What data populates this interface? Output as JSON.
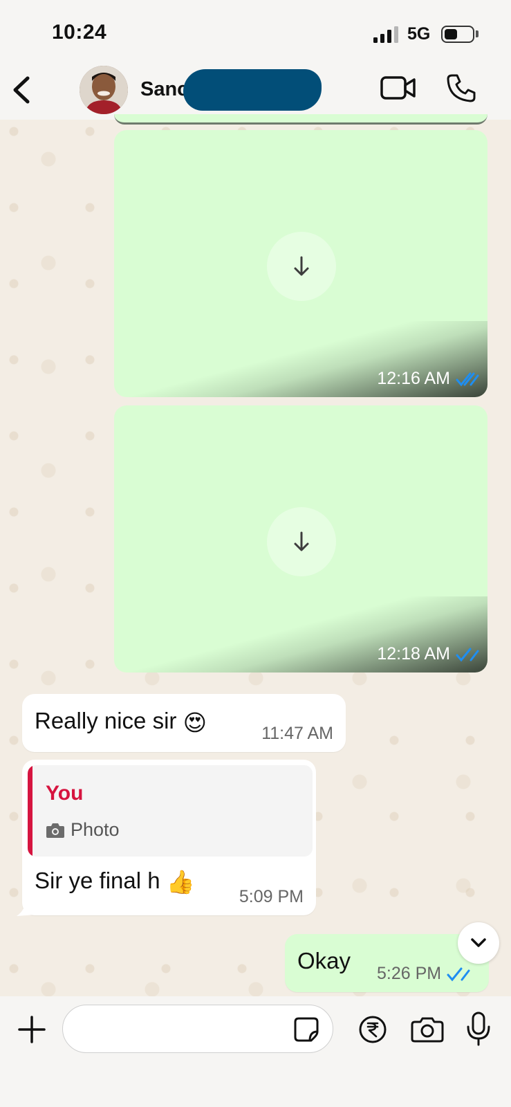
{
  "status_bar": {
    "time": "10:24",
    "network": "5G",
    "icons": [
      "signal-icon",
      "battery-icon"
    ]
  },
  "header": {
    "contact_name": "Sanc",
    "icons": [
      "back-icon",
      "video-call-icon",
      "voice-call-icon"
    ]
  },
  "messages": [
    {
      "type": "image",
      "direction": "outgoing",
      "time": "12:16 AM",
      "status": "read"
    },
    {
      "type": "image",
      "direction": "outgoing",
      "time": "12:18 AM",
      "status": "read"
    },
    {
      "type": "text",
      "direction": "incoming",
      "text": "Really nice sir",
      "emoji": "😍",
      "time": "11:47 AM"
    },
    {
      "type": "reply",
      "direction": "incoming",
      "quote": {
        "author": "You",
        "content": "Photo"
      },
      "text": "Sir ye final h",
      "emoji": "👍",
      "time": "5:09 PM"
    },
    {
      "type": "text",
      "direction": "outgoing",
      "text": "Okay",
      "time": "5:26 PM",
      "status": "read"
    }
  ],
  "input_bar": {
    "placeholder": "",
    "icons": [
      "plus-icon",
      "sticker-icon",
      "rupee-payment-icon",
      "camera-icon",
      "mic-icon"
    ]
  },
  "colors": {
    "outgoing_bubble": "#d9fdd3",
    "incoming_bubble": "#ffffff",
    "read_ticks": "#1f8ef1",
    "reply_accent": "#d6143f",
    "redaction": "#024e78"
  }
}
